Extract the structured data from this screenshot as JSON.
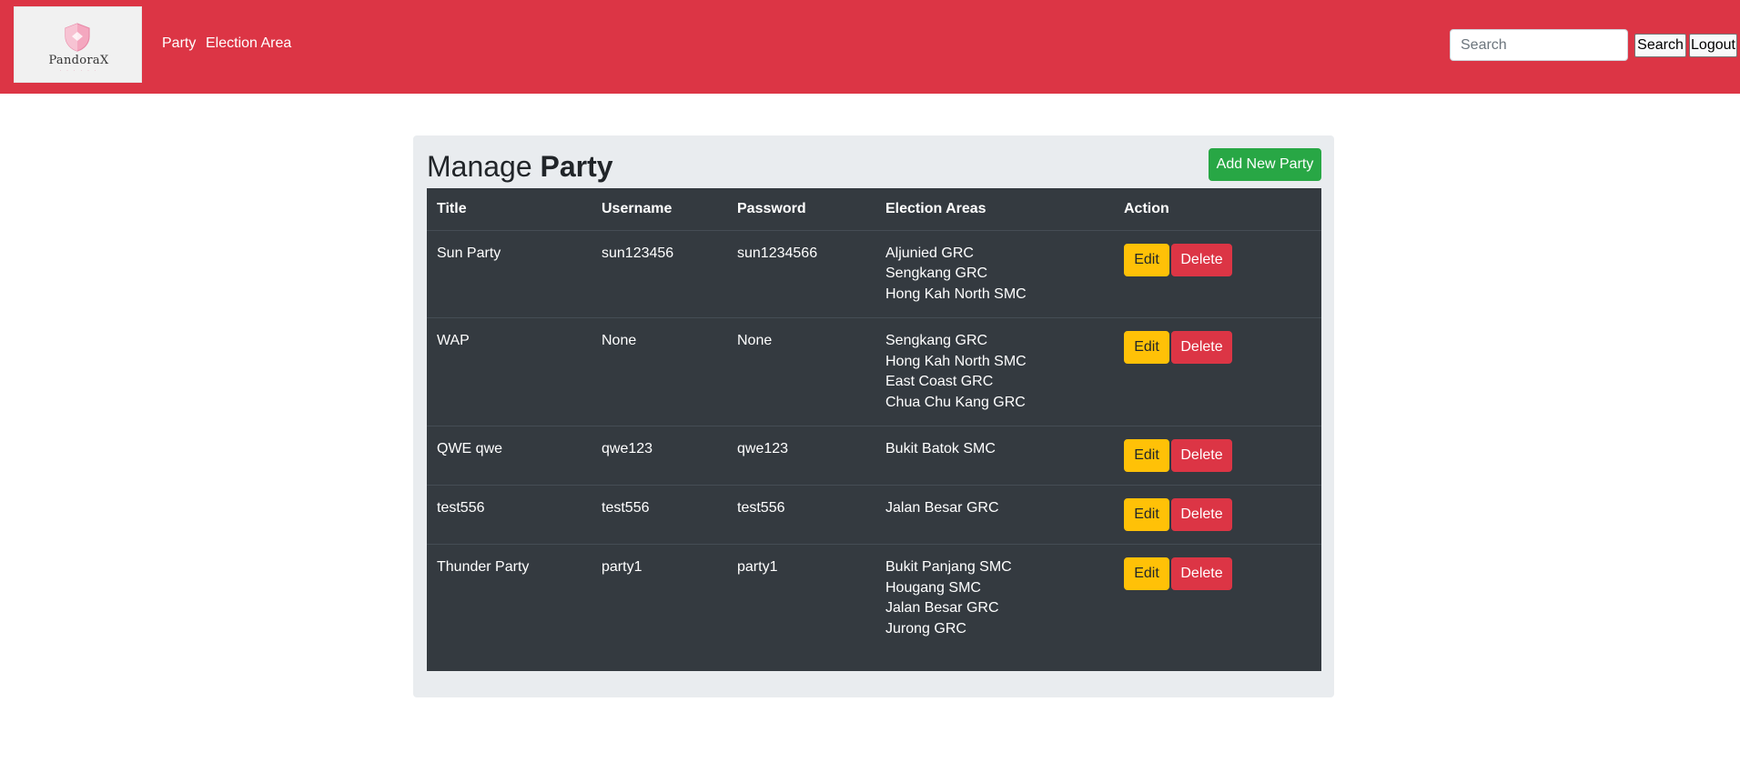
{
  "header": {
    "logo_text": "PandoraX",
    "logo_icon": "shield-icon",
    "brand_color": "#dc3545",
    "nav": [
      {
        "label": "Party"
      },
      {
        "label": "Election Area"
      }
    ],
    "search": {
      "placeholder": "Search",
      "value": ""
    },
    "search_button": "Search",
    "logout_button": "Logout"
  },
  "main": {
    "title_prefix": "Manage ",
    "title_bold": "Party",
    "add_button": "Add New Party",
    "table": {
      "columns": [
        "Title",
        "Username",
        "Password",
        "Election Areas",
        "Action"
      ],
      "rows": [
        {
          "title": "Sun Party",
          "username": "sun123456",
          "password": "sun1234566",
          "areas": [
            "Aljunied GRC",
            "Sengkang GRC",
            "Hong Kah North SMC"
          ]
        },
        {
          "title": "WAP",
          "username": "None",
          "password": "None",
          "areas": [
            "Sengkang GRC",
            "Hong Kah North SMC",
            "East Coast GRC",
            "Chua Chu Kang GRC"
          ]
        },
        {
          "title": "QWE qwe",
          "username": "qwe123",
          "password": "qwe123",
          "areas": [
            "Bukit Batok SMC"
          ]
        },
        {
          "title": "test556",
          "username": "test556",
          "password": "test556",
          "areas": [
            "Jalan Besar GRC"
          ]
        },
        {
          "title": "Thunder Party",
          "username": "party1",
          "password": "party1",
          "areas": [
            "Bukit Panjang SMC",
            "Hougang SMC",
            "Jalan Besar GRC",
            "Jurong GRC"
          ]
        }
      ],
      "edit_label": "Edit",
      "delete_label": "Delete"
    }
  }
}
